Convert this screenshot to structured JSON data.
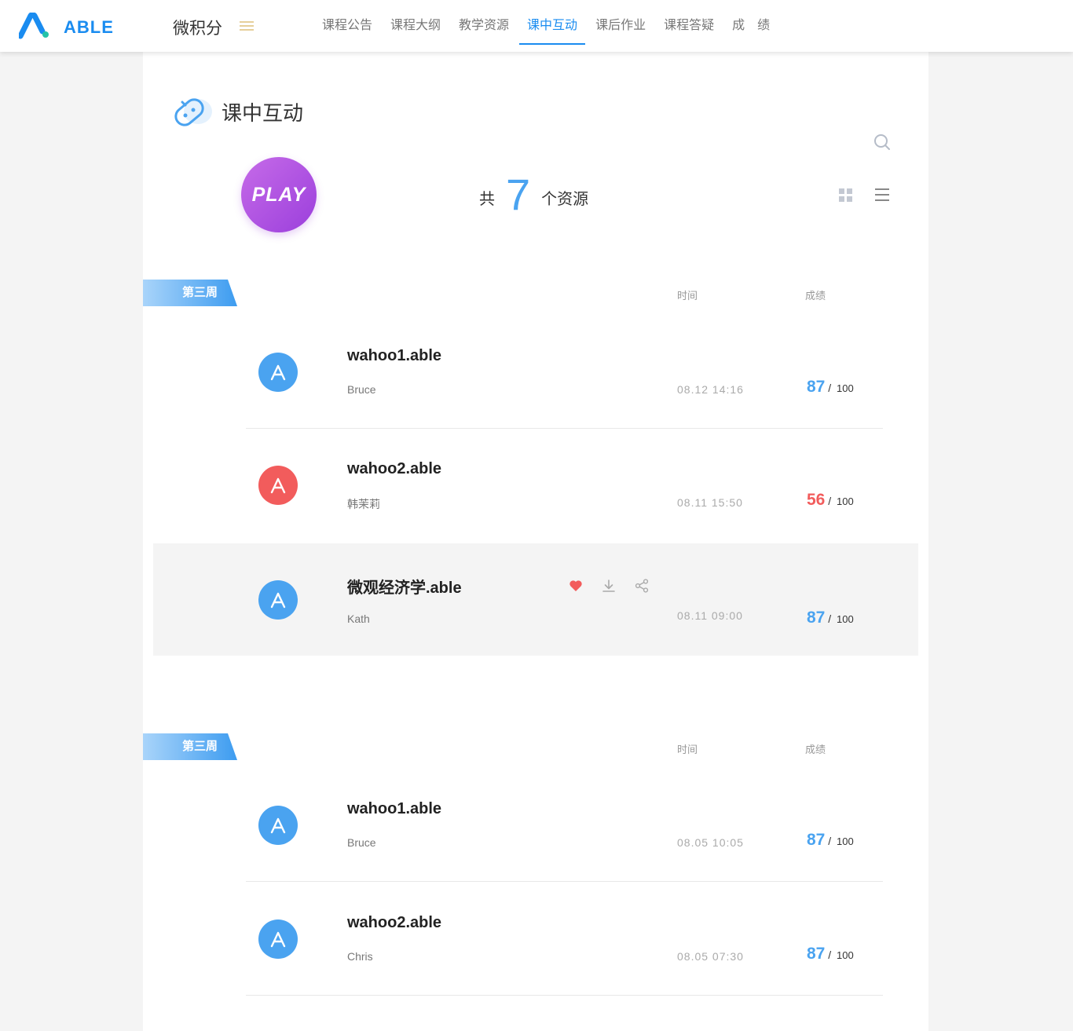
{
  "header": {
    "brand": "ABLE",
    "app_title": "微积分",
    "nav": [
      {
        "label": "课程公告",
        "active": false
      },
      {
        "label": "课程大纲",
        "active": false
      },
      {
        "label": "教学资源",
        "active": false
      },
      {
        "label": "课中互动",
        "active": true
      },
      {
        "label": "课后作业",
        "active": false
      },
      {
        "label": "课程答疑",
        "active": false
      },
      {
        "label": "成　绩",
        "active": false
      }
    ]
  },
  "page": {
    "title": "课中互动",
    "badge": "PLAY",
    "count_prefix": "共",
    "count": "7",
    "count_suffix": "个资源"
  },
  "sections": [
    {
      "week": "第三周",
      "col_time": "时间",
      "col_score": "成绩",
      "rows": [
        {
          "title": "wahoo1.able",
          "user": "Bruce",
          "time": "08.12 14:16",
          "score": "87",
          "total": "100",
          "avatar_color": "blue",
          "score_color": "blue"
        },
        {
          "title": "wahoo2.able",
          "user": "韩茉莉",
          "time": "08.11 15:50",
          "score": "56",
          "total": "100",
          "avatar_color": "red",
          "score_color": "red"
        },
        {
          "title": "微观经济学.able",
          "user": "Kath",
          "time": "08.11 09:00",
          "score": "87",
          "total": "100",
          "avatar_color": "blue",
          "score_color": "blue",
          "highlighted": true
        }
      ]
    },
    {
      "week": "第三周",
      "col_time": "时间",
      "col_score": "成绩",
      "rows": [
        {
          "title": "wahoo1.able",
          "user": "Bruce",
          "time": "08.05 10:05",
          "score": "87",
          "total": "100",
          "avatar_color": "blue",
          "score_color": "blue"
        },
        {
          "title": "wahoo2.able",
          "user": "Chris",
          "time": "08.05 07:30",
          "score": "87",
          "total": "100",
          "avatar_color": "blue",
          "score_color": "blue"
        }
      ]
    }
  ],
  "icons": {
    "logo": "able-logo-icon",
    "menu": "menu-icon",
    "page": "gamepad-icon",
    "search": "search-icon",
    "grid": "grid-view-icon",
    "list": "list-view-icon",
    "avatar": "able-a-icon",
    "favorite": "heart-icon",
    "download": "download-icon",
    "share": "share-icon"
  },
  "colors": {
    "accent": "#1a8cf0",
    "score_blue": "#4aa3f0",
    "score_red": "#f25c5c",
    "play_gradient_start": "#c66be8",
    "play_gradient_end": "#9b3fdc",
    "favorite": "#f25c5c"
  }
}
